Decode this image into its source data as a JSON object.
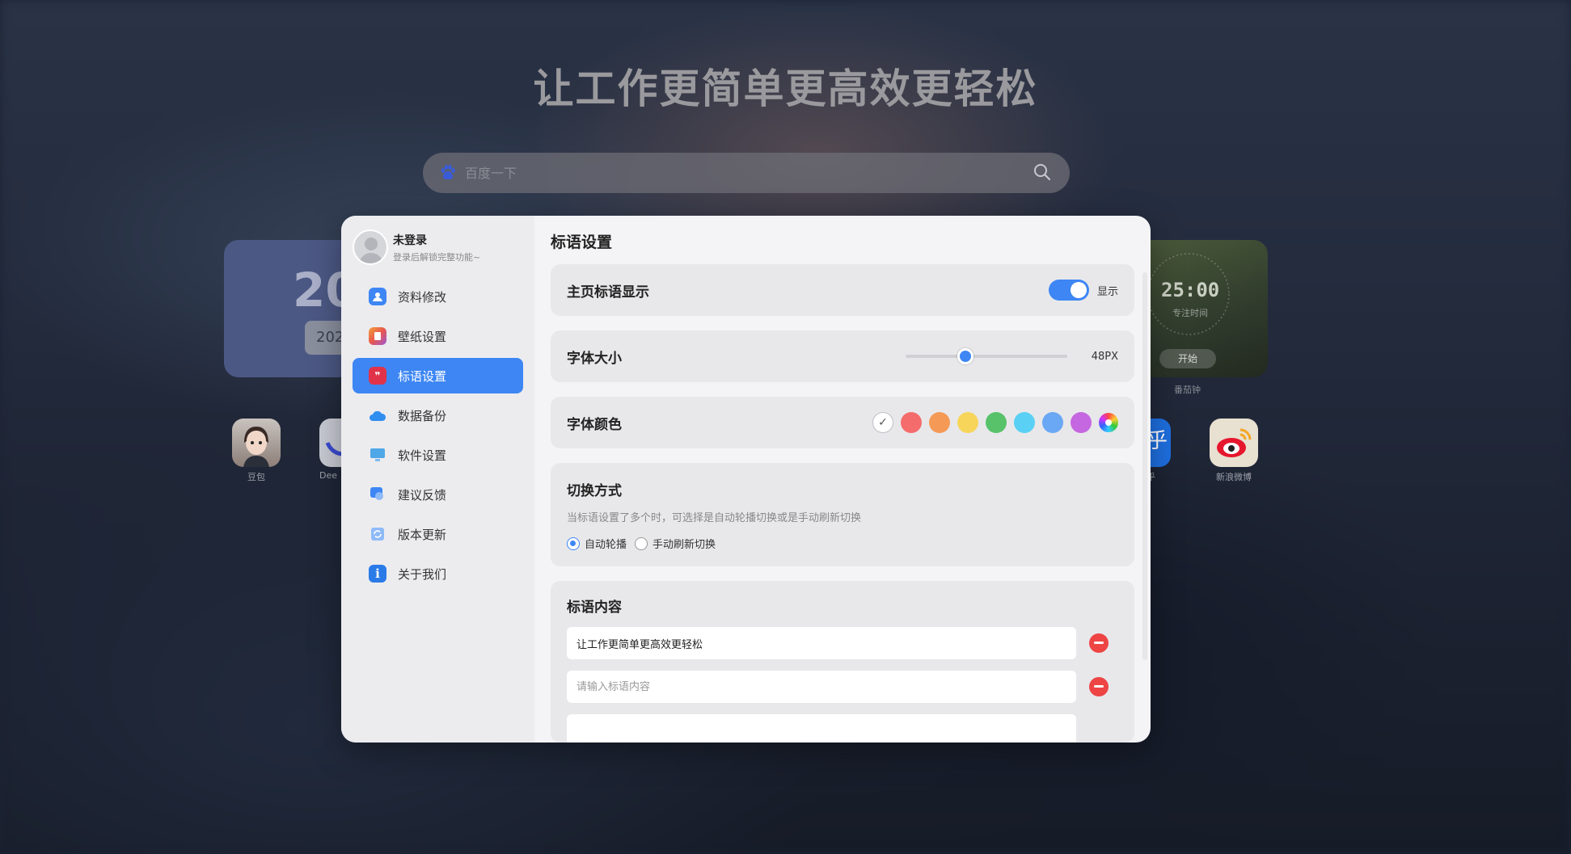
{
  "background": {
    "slogan": "让工作更简单更高效更轻松",
    "search": {
      "placeholder": "百度一下"
    },
    "calendar_widget": {
      "big": "20",
      "pill": "202"
    },
    "timer_widget": {
      "time": "25:00",
      "label": "专注时间",
      "start": "开始",
      "caption": "番茄钟"
    },
    "apps": [
      {
        "name": "豆包",
        "icon": "doubao-icon"
      },
      {
        "name": "Dee",
        "icon": "deepseek-icon"
      },
      {
        "name": "乎",
        "icon": "zhihu-icon"
      },
      {
        "name": "新浪微博",
        "icon": "weibo-icon"
      }
    ]
  },
  "modal": {
    "user": {
      "name": "未登录",
      "subtitle": "登录后解锁完整功能~"
    },
    "nav": [
      {
        "label": "资料修改",
        "icon": "profile-icon",
        "color": "#3d86f4"
      },
      {
        "label": "壁纸设置",
        "icon": "wallpaper-icon",
        "color": "#e8574e"
      },
      {
        "label": "标语设置",
        "icon": "quote-icon",
        "color": "#e0334a",
        "active": true
      },
      {
        "label": "数据备份",
        "icon": "cloud-icon",
        "color": "#2f8ef0"
      },
      {
        "label": "软件设置",
        "icon": "monitor-icon",
        "color": "#4fa7e8"
      },
      {
        "label": "建议反馈",
        "icon": "feedback-icon",
        "color": "#3d86f4"
      },
      {
        "label": "版本更新",
        "icon": "update-icon",
        "color": "#5a9cf0"
      },
      {
        "label": "关于我们",
        "icon": "info-icon",
        "color": "#2a7ae8"
      }
    ],
    "title": "标语设置",
    "display": {
      "label": "主页标语显示",
      "toggle_label": "显示",
      "on": true
    },
    "font_size": {
      "label": "字体大小",
      "value_text": "48PX",
      "fraction": 0.37
    },
    "font_color": {
      "label": "字体颜色",
      "swatches": [
        "#ffffff",
        "#f56c6c",
        "#f59a56",
        "#f7d55a",
        "#58c26a",
        "#5ad0f5",
        "#6aa8f5",
        "#c567e0"
      ],
      "custom_icon": "color-wheel-icon"
    },
    "switch_mode": {
      "label": "切换方式",
      "desc": "当标语设置了多个时，可选择是自动轮播切换或是手动刷新切换",
      "options": [
        "自动轮播",
        "手动刷新切换"
      ],
      "selected": 0
    },
    "content": {
      "label": "标语内容",
      "items": [
        {
          "value": "让工作更简单更高效更轻松",
          "placeholder": "请输入标语内容"
        },
        {
          "value": "",
          "placeholder": "请输入标语内容"
        }
      ]
    },
    "accent_color": "#3d86f4"
  }
}
